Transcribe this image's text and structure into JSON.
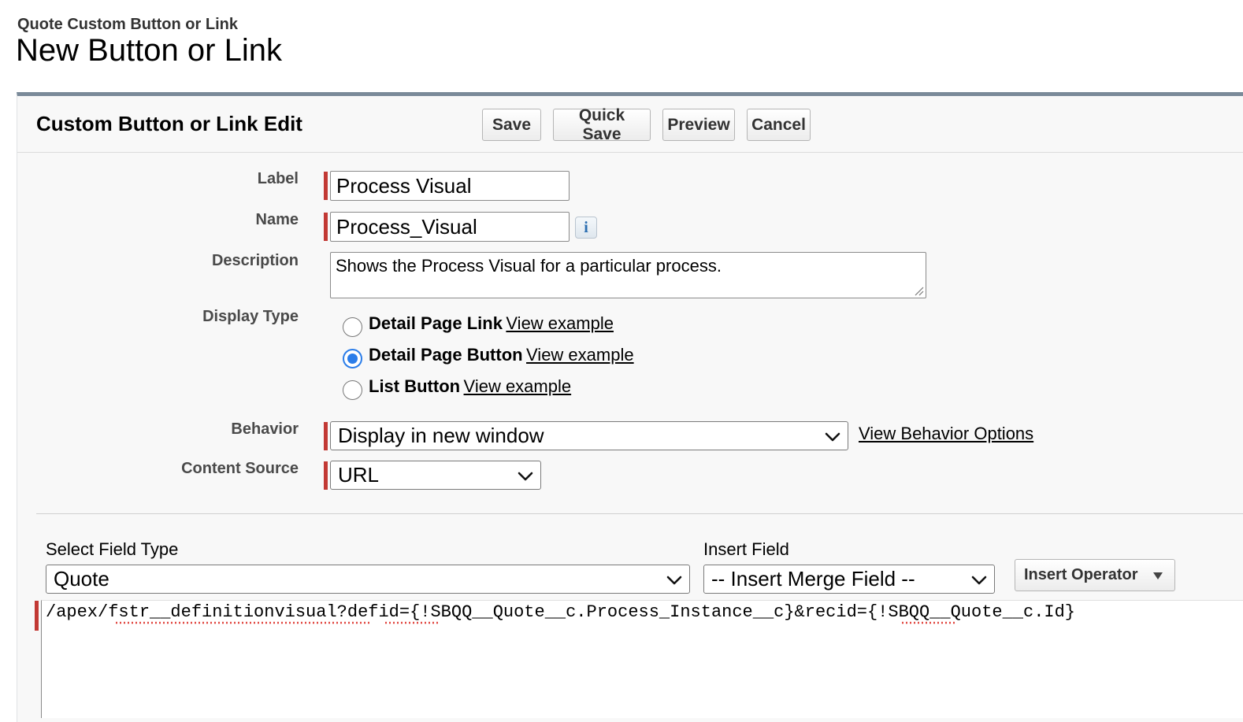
{
  "header": {
    "subtitle": "Quote Custom Button or Link",
    "title": "New Button or Link"
  },
  "panel": {
    "title": "Custom Button or Link Edit",
    "buttons": {
      "save": "Save",
      "quick_save": "Quick Save",
      "preview": "Preview",
      "cancel": "Cancel"
    }
  },
  "form": {
    "label": {
      "label": "Label",
      "value": "Process Visual"
    },
    "name": {
      "label": "Name",
      "value": "Process_Visual",
      "info_icon": "i"
    },
    "description": {
      "label": "Description",
      "value": "Shows the Process Visual for a particular process."
    },
    "display_type": {
      "label": "Display Type",
      "options": [
        {
          "label": "Detail Page Link",
          "link": "View example",
          "selected": false
        },
        {
          "label": "Detail Page Button",
          "link": "View example",
          "selected": true
        },
        {
          "label": "List Button",
          "link": "View example",
          "selected": false
        }
      ]
    },
    "behavior": {
      "label": "Behavior",
      "value": "Display in new window",
      "link": "View Behavior Options"
    },
    "content_source": {
      "label": "Content Source",
      "value": "URL"
    }
  },
  "editor": {
    "select_field_type": {
      "label": "Select Field Type",
      "value": "Quote"
    },
    "insert_field": {
      "label": "Insert Field",
      "value": "-- Insert Merge Field --"
    },
    "insert_operator": "Insert Operator",
    "code": "/apex/fstr__definitionvisual?defid={!SBQQ__Quote__c.Process_Instance__c}&recid={!SBQQ__Quote__c.Id}"
  },
  "colors": {
    "required": "#c23934",
    "radio_selected": "#2b7de9",
    "panel_border": "#7a8a99"
  },
  "icons": {
    "info": "info-icon",
    "dropdown": "chevron-down-icon",
    "operator": "triangle-down-icon",
    "resize": "resize-grip-icon"
  }
}
